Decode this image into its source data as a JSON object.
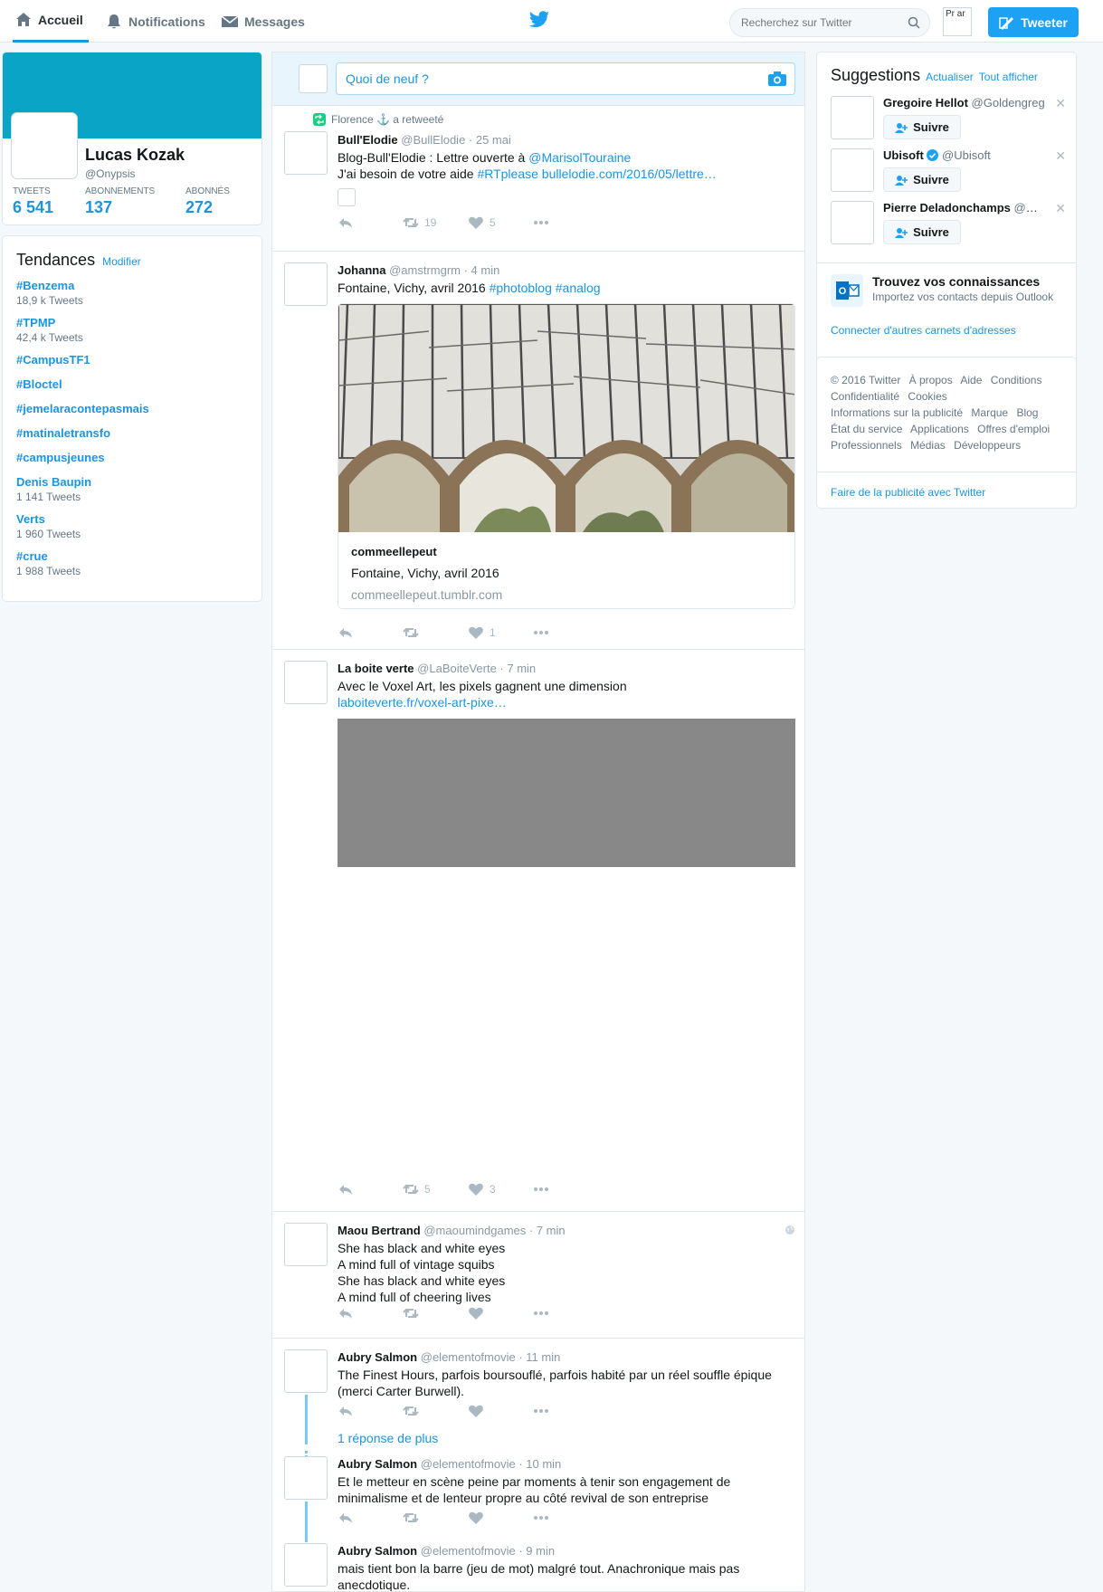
{
  "nav": {
    "home": "Accueil",
    "notifications": "Notifications",
    "messages": "Messages",
    "search_placeholder": "Recherchez sur Twitter",
    "avatar_alt": "Pr ar",
    "tweet_button": "Tweeter"
  },
  "profile": {
    "name": "Lucas Kozak",
    "handle": "@Onypsis",
    "stats": [
      {
        "label": "Tweets",
        "value": "6 541"
      },
      {
        "label": "Abonnements",
        "value": "137"
      },
      {
        "label": "Abonnés",
        "value": "272"
      }
    ]
  },
  "trends": {
    "title": "Tendances",
    "modify": "Modifier",
    "items": [
      {
        "name": "#Benzema",
        "count": "18,9 k Tweets"
      },
      {
        "name": "#TPMP",
        "count": "42,4 k Tweets"
      },
      {
        "name": "#CampusTF1",
        "count": ""
      },
      {
        "name": "#Bloctel",
        "count": ""
      },
      {
        "name": "#jemelaracontepasmais",
        "count": ""
      },
      {
        "name": "#matinaletransfo",
        "count": ""
      },
      {
        "name": "#campusjeunes",
        "count": ""
      },
      {
        "name": "Denis Baupin",
        "count": "1 141 Tweets"
      },
      {
        "name": "Verts",
        "count": "1 960 Tweets"
      },
      {
        "name": "#crue",
        "count": "1 988 Tweets"
      }
    ]
  },
  "compose": {
    "placeholder": "Quoi de neuf ?"
  },
  "tweets": [
    {
      "context": "Florence ⚓ a retweeté",
      "name": "Bull'Elodie",
      "handle": "@BullElodie · 25 mai",
      "line1_pre": "Blog-Bull'Elodie : Lettre ouverte à ",
      "line1_link": "@MarisolTouraine",
      "line2_pre": "J'ai besoin de votre aide ",
      "line2_link": "#RTplease bullelodie.com/2016/05/lettre…",
      "retweets": "19",
      "likes": "5"
    },
    {
      "name": "Johanna",
      "handle": "@amstrmgrm · 4 min",
      "text_pre": "Fontaine, Vichy, avril 2016 ",
      "text_link": "#photoblog #analog",
      "card_title": "commeellepeut",
      "card_desc": "Fontaine, Vichy, avril 2016",
      "card_url": "commeellepeut.tumblr.com",
      "likes": "1"
    },
    {
      "name": "La boite verte",
      "handle": "@LaBoiteVerte · 7 min",
      "text": "Avec le Voxel Art, les pixels gagnent une dimension",
      "link": "laboiteverte.fr/voxel-art-pixe…",
      "retweets": "5",
      "likes": "3"
    },
    {
      "name": "Maou Bertrand",
      "handle": "@maoumindgames · 7 min",
      "lines": [
        "She has black and white eyes",
        "A mind full of vintage squibs",
        "She has black and white eyes",
        "A mind full of cheering lives"
      ]
    },
    {
      "name": "Aubry Salmon",
      "handle": "@elementofmovie · 11 min",
      "lines": [
        "The Finest Hours, parfois boursouflé, parfois habité par un réel souffle épique",
        "(merci Carter Burwell)."
      ],
      "more_replies": "1 réponse de plus"
    },
    {
      "name": "Aubry Salmon",
      "handle": "@elementofmovie · 10 min",
      "lines": [
        "Et le metteur en scène peine par moments à tenir son  engagement de",
        "minimalisme et de lenteur propre au côté revival de son  entreprise"
      ]
    },
    {
      "name": "Aubry Salmon",
      "handle": "@elementofmovie · 9 min",
      "lines": [
        "mais  tient bon la barre (jeu de mot) malgré tout. Anachronique  mais pas",
        "anecdotique."
      ]
    }
  ],
  "suggestions": {
    "title": "Suggestions",
    "refresh": "Actualiser",
    "view_all": "Tout afficher",
    "follow_label": "Suivre",
    "items": [
      {
        "name": "Gregoire Hellot",
        "handle": "@Goldengreg"
      },
      {
        "name": "Ubisoft",
        "handle": "@Ubisoft",
        "verified": true
      },
      {
        "name": "Pierre Deladonchamps",
        "handle": "@De.."
      }
    ],
    "contacts_title": "Trouvez vos connaissances",
    "contacts_sub": "Importez vos contacts depuis Outlook",
    "connect": "Connecter d'autres carnets d'adresses"
  },
  "footer": {
    "links": [
      "© 2016 Twitter",
      "À propos",
      "Aide",
      "Conditions",
      "Confidentialité",
      "Cookies",
      "Informations sur la publicité",
      "Marque",
      "Blog",
      "État du service",
      "Applications",
      "Offres d'emploi",
      "Professionnels",
      "Médias",
      "Développeurs"
    ],
    "ad": "Faire de la publicité avec Twitter"
  },
  "colors": {
    "accent": "#1b95e0",
    "banner": "#0aa5c6",
    "retweet_green": "#19cf86"
  }
}
